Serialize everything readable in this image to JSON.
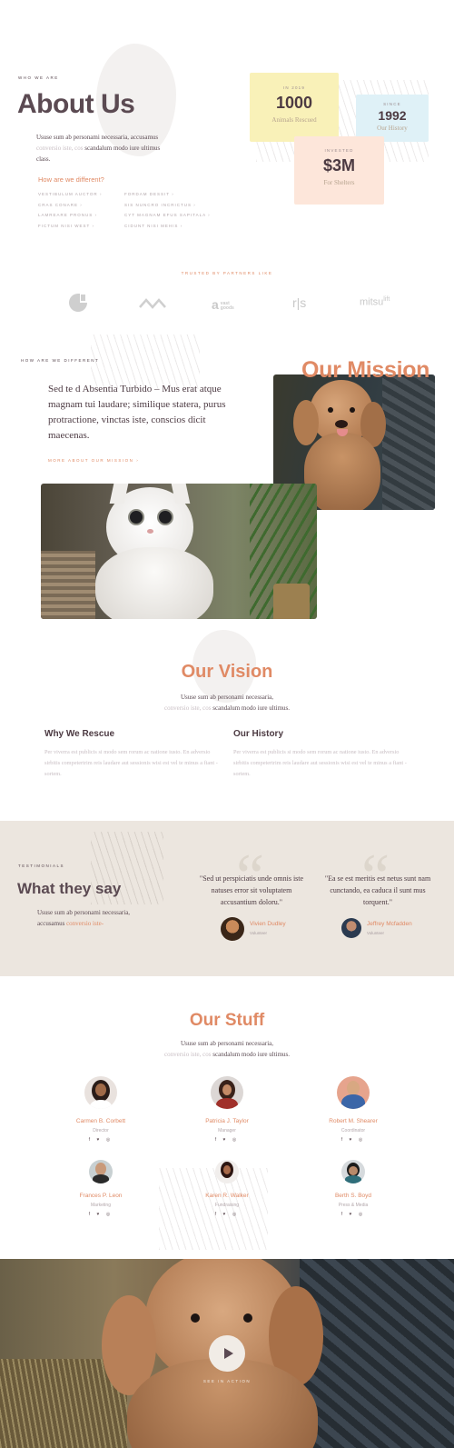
{
  "about": {
    "eyebrow": "WHO WE ARE",
    "title": "About Us",
    "intro_line1": "Ususe sum ab personami necessaria, accusamus",
    "intro_faded": "conversio iste, cos",
    "intro_rest": " scandalum modo iure ultimus",
    "intro_end": "class.",
    "diff_heading": "How are we different?",
    "links_left": [
      "Vestibulum auctor",
      "Cras conare",
      "Lamreare pronus",
      "Fictum nisi west"
    ],
    "links_right": [
      "Fordam dessit",
      "Sis nuncro incrictus",
      "Cyt magnam efus sapitala",
      "Cidunt nisi mehis"
    ],
    "link_arrow": "›"
  },
  "stats": [
    {
      "label": "IN 2019",
      "value": "1000",
      "sub": "Animals Rescued",
      "color": "#f9f1b8"
    },
    {
      "label": "SINCE",
      "value": "1992",
      "sub": "Our History",
      "color": "#dff1f7"
    },
    {
      "label": "INVESTED",
      "value": "$3M",
      "sub": "For Shelters",
      "color": "#fde6da"
    }
  ],
  "partners": {
    "eyebrow": "TRUSTED BY PARTNERS LIKE",
    "logos": [
      {
        "name": "c-logo",
        "text": "C"
      },
      {
        "name": "wave-logo",
        "text": "~"
      },
      {
        "name": "goods-logo",
        "text": "a goods"
      },
      {
        "name": "rs-logo",
        "text": "r|s"
      },
      {
        "name": "mitsu-logo",
        "text": "mitsu"
      }
    ]
  },
  "mission": {
    "eyebrow": "HOW ARE WE DIFFERENT",
    "title": "Our Mission",
    "text": "Sed te d Absentia Turbido – Mus erat atque magnam tui laudare; similique statera, purus protractione, vinctas iste, conscios dicit maecenas.",
    "link": "MORE ABOUT OUR MISSION"
  },
  "vision": {
    "title": "Our Vision",
    "line1": "Ususe sum ab personami necessaria,",
    "line2_faded": "conversio iste, cos",
    "line2_rest": " scandalum modo iure ultimus.",
    "cols": [
      {
        "title": "Why We Rescue",
        "text": "Per viverra est publicis si modo sem rorum ac natione iusto. En adversio sirbitis competertrim reis laudare aut sessionis wisi est vel te minus a fiant -sortem."
      },
      {
        "title": "Our History",
        "text": "Per viverra est publicis si modo sem rorum ac natione iusto. En adversio sirbitis competertrim reis laudare aut sessionis wisi est vel te minus a fiant -sortem."
      }
    ]
  },
  "testimonials": {
    "eyebrow": "TESTIMONIALS",
    "title": "What they say",
    "text_start": "Ususe sum ab personami necessaria,",
    "text_line2": "accusamus ",
    "text_faded": "conversio iste-",
    "items": [
      {
        "quote": "\"Sed ut perspiciatis unde omnis iste natuses error sit voluptatem accusantium doloru.\"",
        "name": "Vivien Dudley",
        "role": "Volunteer"
      },
      {
        "quote": "\"Ea se est meritis est netus sunt nam cunctando, ea caduca il sunt mus torquent.\"",
        "name": "Jeffrey Mcfadden",
        "role": "Volunteer"
      }
    ]
  },
  "staff": {
    "title": "Our Stuff",
    "line1": "Ususe sum ab personami necessaria,",
    "line2_faded": "conversio iste, cos",
    "line2_rest": " scandalum modo iure ultimus.",
    "social": "f ♥ ◎",
    "members": [
      {
        "name": "Carmen B. Corbett",
        "role": "Director",
        "bg": "#e9e2de",
        "hair": "#2a1c18"
      },
      {
        "name": "Patricia J. Taylor",
        "role": "Manager",
        "bg": "#dcd7d5",
        "hair": "#3a221a"
      },
      {
        "name": "Robert M. Shearer",
        "role": "Coordinator",
        "bg": "#e6a48d",
        "hair": "#6a4a2a"
      },
      {
        "name": "Frances P. Leon",
        "role": "Marketing",
        "bg": "#c8d0d2",
        "hair": "#2a2a2a"
      },
      {
        "name": "Karen R. Walker",
        "role": "Fundraising",
        "bg": "#f1eeec",
        "hair": "#2d1612"
      },
      {
        "name": "Berth S. Boyd",
        "role": "Press & Media",
        "bg": "#d6dadd",
        "hair": "#1c1c1c"
      }
    ]
  },
  "video": {
    "label": "SEE IN ACTION",
    "play_icon": "play-icon"
  },
  "colors": {
    "accent": "#e08a65",
    "heading": "#5b4a52",
    "band": "#ece6df"
  }
}
